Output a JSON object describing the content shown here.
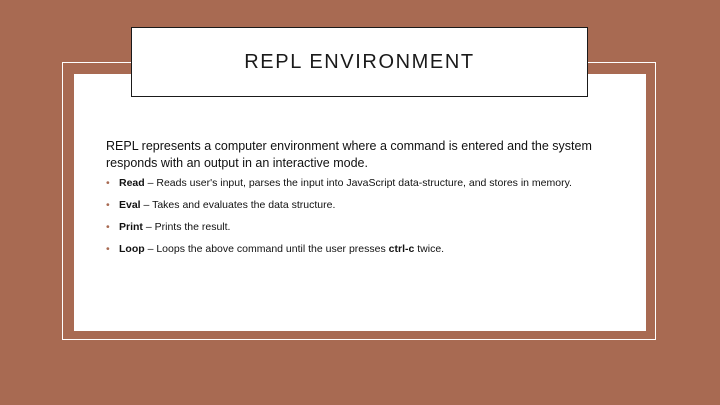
{
  "slide": {
    "title": "REPL ENVIRONMENT",
    "intro": "REPL represents a computer environment where a command is entered and the system responds with an output in an interactive mode.",
    "bullet_glyph": "•",
    "items": [
      {
        "term": "Read",
        "separator": " – ",
        "text": "Reads user's input, parses the input into JavaScript data-structure, and stores in memory.",
        "emphasis": "",
        "tail": ""
      },
      {
        "term": "Eval",
        "separator": " – ",
        "text": "Takes and evaluates the data structure.",
        "emphasis": "",
        "tail": ""
      },
      {
        "term": "Print",
        "separator": " – ",
        "text": "Prints the result.",
        "emphasis": "",
        "tail": ""
      },
      {
        "term": "Loop",
        "separator": " – ",
        "text": "Loops the above command until the user presses ",
        "emphasis": "ctrl-c",
        "tail": " twice."
      }
    ]
  },
  "colors": {
    "background": "#a86a52",
    "panel": "#ffffff",
    "accent": "#a86a52",
    "text": "#111111"
  }
}
